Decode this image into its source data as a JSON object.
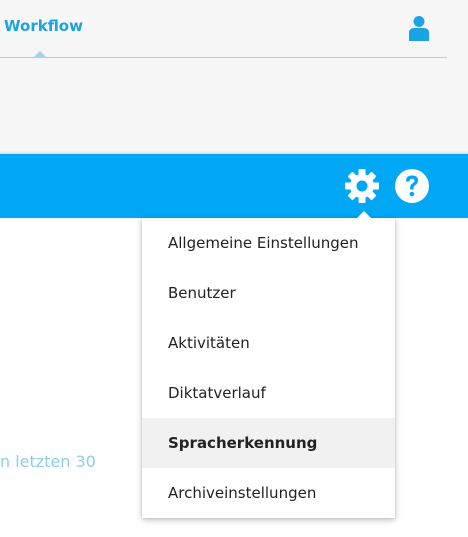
{
  "header": {
    "tab_label": "Workflow",
    "user_icon": "user-icon"
  },
  "toolbar": {
    "settings_icon": "gear-icon",
    "help_icon": "help-icon",
    "background_color": "#00a7f5"
  },
  "background_text": "n letzten 30",
  "settings_menu": {
    "items": [
      {
        "label": "Allgemeine Einstellungen",
        "active": false
      },
      {
        "label": "Benutzer",
        "active": false
      },
      {
        "label": "Aktivitäten",
        "active": false
      },
      {
        "label": "Diktatverlauf",
        "active": false
      },
      {
        "label": "Spracherkennung",
        "active": true
      },
      {
        "label": "Archiveinstellungen",
        "active": false
      }
    ]
  },
  "colors": {
    "accent": "#1ba4e4",
    "menu_active_bg": "#f1f1f1"
  }
}
